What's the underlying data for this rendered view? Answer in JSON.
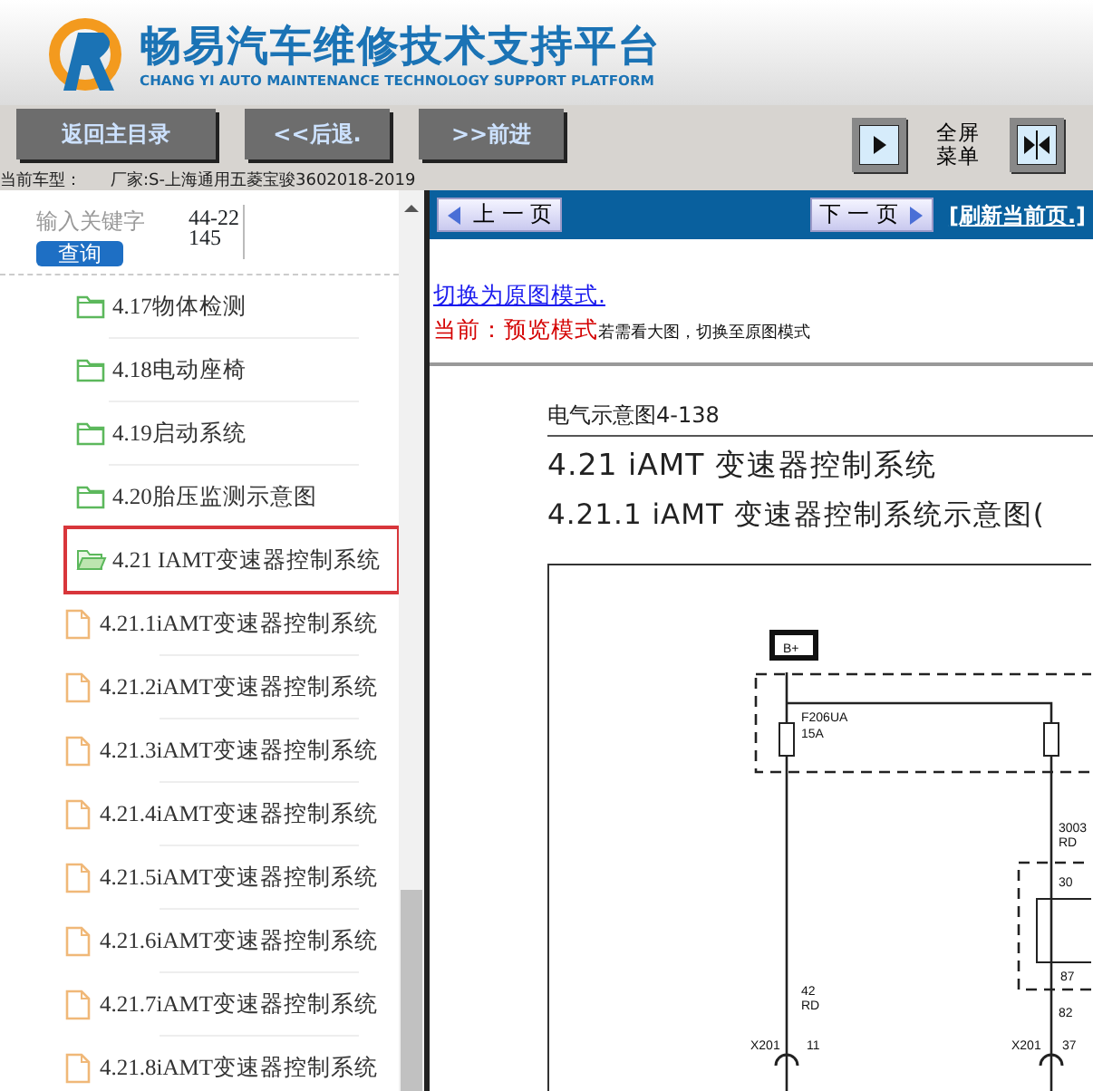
{
  "header": {
    "title": "畅易汽车维修技术支持平台",
    "subtitle": "CHANG YI AUTO MAINTENANCE TECHNOLOGY SUPPORT PLATFORM"
  },
  "toolbar": {
    "buttons": [
      "返回主目录",
      "<<后退.",
      ">>前进"
    ],
    "fullscreen_label": "全屏菜单"
  },
  "vehicle": {
    "label": "当前车型：",
    "value": "厂家:S-上海通用五菱宝骏3602018-2019"
  },
  "search": {
    "label": "输入关键字",
    "value": "44-22145",
    "button": "查询"
  },
  "tree": [
    {
      "label": "4.17物体检测",
      "kind": "folder",
      "expanded": false,
      "selected": false
    },
    {
      "label": "4.18电动座椅",
      "kind": "folder",
      "expanded": false,
      "selected": false
    },
    {
      "label": "4.19启动系统",
      "kind": "folder",
      "expanded": false,
      "selected": false
    },
    {
      "label": "4.20胎压监测示意图",
      "kind": "folder",
      "expanded": false,
      "selected": false
    },
    {
      "label": "4.21 IAMT变速器控制系统",
      "kind": "folder",
      "expanded": true,
      "selected": true,
      "children": [
        {
          "label": "4.21.1iAMT变速器控制系统",
          "kind": "file",
          "selected": false
        },
        {
          "label": "4.21.2iAMT变速器控制系统",
          "kind": "file",
          "selected": false
        },
        {
          "label": "4.21.3iAMT变速器控制系统",
          "kind": "file",
          "selected": false
        },
        {
          "label": "4.21.4iAMT变速器控制系统",
          "kind": "file",
          "selected": false
        },
        {
          "label": "4.21.5iAMT变速器控制系统",
          "kind": "file",
          "selected": false
        },
        {
          "label": "4.21.6iAMT变速器控制系统",
          "kind": "file",
          "selected": false
        },
        {
          "label": "4.21.7iAMT变速器控制系统",
          "kind": "file",
          "selected": false
        },
        {
          "label": "4.21.8iAMT变速器控制系统",
          "kind": "file",
          "selected": false
        }
      ]
    }
  ],
  "nav_bar": {
    "prev": "上 一 页",
    "next": "下 一 页",
    "refresh": "[刷新当前页.]"
  },
  "mode": {
    "switch_link": "切换为原图模式.",
    "current_label": "当前：预览模式",
    "hint": "若需看大图，切换至原图模式"
  },
  "document": {
    "page_label": "电气示意图4-138",
    "heading": "4.21 iAMT 变速器控制系统",
    "subheading": "4.21.1 iAMT 变速器控制系统示意图(",
    "diagram_labels": [
      "B+",
      "F206UA",
      "15A",
      "3003",
      "RD",
      "30",
      "87",
      "42",
      "RD",
      "82",
      "X201",
      "11",
      "X201",
      "37"
    ]
  }
}
